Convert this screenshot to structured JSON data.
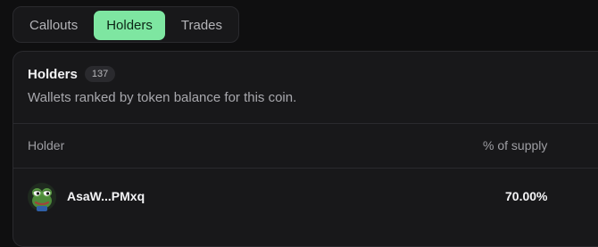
{
  "tabs": [
    {
      "label": "Callouts",
      "active": false
    },
    {
      "label": "Holders",
      "active": true
    },
    {
      "label": "Trades",
      "active": false
    }
  ],
  "holders": {
    "title": "Holders",
    "count": "137",
    "description": "Wallets ranked by token balance for this coin.",
    "columns": {
      "holder": "Holder",
      "supply": "% of supply"
    },
    "rows": [
      {
        "avatar_icon": "pepe-frog-icon",
        "address": "AsaW...PMxq",
        "supply_pct": "70.00%"
      }
    ]
  },
  "colors": {
    "accent": "#7ee6a1",
    "background": "#0f0f10",
    "panel": "#18181a"
  }
}
